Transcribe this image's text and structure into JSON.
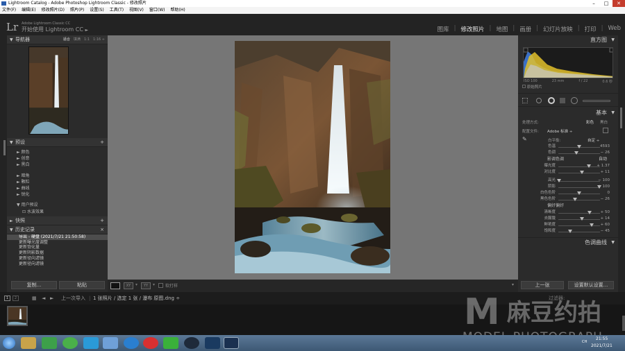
{
  "window": {
    "title": "Lightroom Catalog - Adobe Photoshop Lightroom Classic - 修改照片",
    "controls": [
      "–",
      "□",
      "✕"
    ]
  },
  "menubar": {
    "items": [
      "文件(F)",
      "编辑(E)",
      "修改照片(D)",
      "照片(P)",
      "设置(S)",
      "工具(T)",
      "视图(V)",
      "窗口(W)",
      "帮助(H)"
    ]
  },
  "identity": {
    "logo": "Lr",
    "app_small": "Adobe Lightroom Classic CC",
    "title": "开始使用 Lightroom CC",
    "arrow": "►"
  },
  "modules": {
    "items": [
      "图库",
      "修改照片",
      "地图",
      "画册",
      "幻灯片放映",
      "打印",
      "Web"
    ],
    "active": "修改照片"
  },
  "left_panel": {
    "navigator": {
      "title": "导航器",
      "options": [
        "适合",
        "填满",
        "1:1",
        "1:16 ÷"
      ],
      "selected": "适合"
    },
    "presets": {
      "title": "预设",
      "group1": [
        "颜色",
        "创意",
        "黑白"
      ],
      "group2": [
        "暗角",
        "颗粒",
        "曲线",
        "锐化"
      ],
      "user": "用户预设",
      "user_item": "水波效果"
    },
    "snapshots": {
      "title": "快照"
    },
    "history": {
      "title": "历史记录",
      "items": [
        "导出 - 硬盘 (2021/7/21 21:50:58)",
        "更新曝光度调整",
        "更新饱化量",
        "更新阴影数据",
        "更新径向滤镜",
        "更新径向滤镜"
      ],
      "selected_index": 0
    },
    "copy_button": "复制...",
    "paste_button": "粘贴"
  },
  "toolbar": {
    "softproof_label": "软打样",
    "view_modes": [
      "□",
      "XY",
      "YY"
    ]
  },
  "right_panel": {
    "histogram_title": "直方图",
    "camera_info": [
      "ISO 100",
      "23 mm",
      "f / 22",
      "0.6 秒"
    ],
    "original_photo_label": "原始照片",
    "basic_title": "基本",
    "treatment_label": "处理方式:",
    "treatment_options": [
      "彩色",
      "黑白"
    ],
    "treatment_selected": "彩色",
    "profile_label": "配置文件:",
    "profile_value": "Adobe 标准 ÷",
    "wb_label": "白平衡:",
    "wb_value": "自定 ÷",
    "wb_sliders": [
      {
        "label": "色温",
        "value": "4593",
        "position": 0.5
      },
      {
        "label": "色调",
        "value": "− 26",
        "position": 0.44
      }
    ],
    "tone_title": "影调色调",
    "tone_auto": "自动",
    "tone_sliders": [
      {
        "label": "曝光度",
        "value": "+ 1.37",
        "position": 0.73
      },
      {
        "label": "对比度",
        "value": "+ 11",
        "position": 0.56
      }
    ],
    "tone2_sliders": [
      {
        "label": "高光",
        "value": "− 100",
        "position": 0.02
      },
      {
        "label": "阴影",
        "value": "+ 100",
        "position": 0.98
      },
      {
        "label": "白色色阶",
        "value": "0",
        "position": 0.5
      },
      {
        "label": "黑色色阶",
        "value": "− 26",
        "position": 0.4
      }
    ],
    "presence_title": "偏好偏好",
    "presence_sliders": [
      {
        "label": "清晰度",
        "value": "+ 50",
        "position": 0.75
      },
      {
        "label": "去朦胧",
        "value": "+ 14",
        "position": 0.57
      },
      {
        "label": "鲜艳度",
        "value": "+ 60",
        "position": 0.8
      },
      {
        "label": "饱和度",
        "value": "− 45",
        "position": 0.28
      }
    ],
    "tone_curve_title": "色调曲线",
    "prev_button": "上一张",
    "reset_button": "设置默认设置..."
  },
  "filmstrip": {
    "pages": [
      "1",
      "2"
    ],
    "source": "上一次导入",
    "info": "1 张照片 / 选定 1 张 / 瀑布 原图.dng ÷",
    "filter_label": "过滤器:"
  },
  "watermark": {
    "letter": "M",
    "chinese": "麻豆约拍",
    "english": "MODEL PHOTOGRAPH"
  },
  "taskbar": {
    "time": "21:55",
    "date": "2021/7/21",
    "lang": "CH"
  },
  "colors": {
    "accent_yellow": "#e2c02a",
    "accent_blue": "#3f7ad8"
  }
}
